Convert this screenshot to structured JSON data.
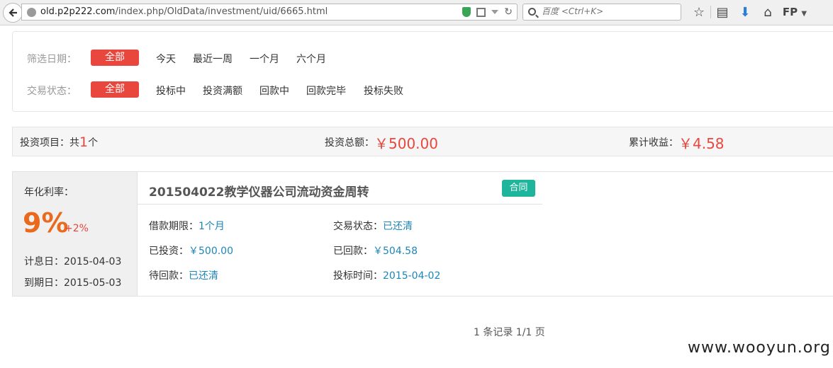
{
  "browser": {
    "url_host": "old.p2p222.com",
    "url_path": "/index.php/OldData/investment/uid/6665.html",
    "search_placeholder": "百度 <Ctrl+K>",
    "profile_label": "FP"
  },
  "filters": {
    "date": {
      "label": "筛选日期：",
      "active": "全部",
      "options": [
        "今天",
        "最近一周",
        "一个月",
        "六个月"
      ]
    },
    "status": {
      "label": "交易状态：",
      "active": "全部",
      "options": [
        "投标中",
        "投资满额",
        "回款中",
        "回款完毕",
        "投标失败"
      ]
    }
  },
  "summary": {
    "projects_label": "投资项目：共",
    "projects_count": "1",
    "projects_unit": "个",
    "total_label": "投资总额：",
    "total_value": "￥500.00",
    "earnings_label": "累计收益：",
    "earnings_value": "￥4.58"
  },
  "card": {
    "rate_label": "年化利率：",
    "rate_value": "9%",
    "rate_bonus": "+2%",
    "start_date_label": "计息日：",
    "start_date": "2015-04-03",
    "end_date_label": "到期日：",
    "end_date": "2015-05-03",
    "title": "201504022教学仪器公司流动资金周转",
    "badge": "合同",
    "fields": {
      "term_label": "借款期限：",
      "term_value": "1个月",
      "status_label": "交易状态：",
      "status_value": "已还清",
      "invested_label": "已投资：",
      "invested_value": "￥500.00",
      "returned_label": "已回款：",
      "returned_value": "￥504.58",
      "pending_label": "待回款：",
      "pending_value": "已还清",
      "bid_time_label": "投标时间：",
      "bid_time_value": "2015-04-02"
    }
  },
  "pager": "1 条记录 1/1 页",
  "watermark": "www.wooyun.org",
  "colors": {
    "accent_red": "#e9473d",
    "rate_orange": "#e96a1c",
    "badge_teal": "#1fb49c",
    "value_blue": "#1d86b8"
  }
}
